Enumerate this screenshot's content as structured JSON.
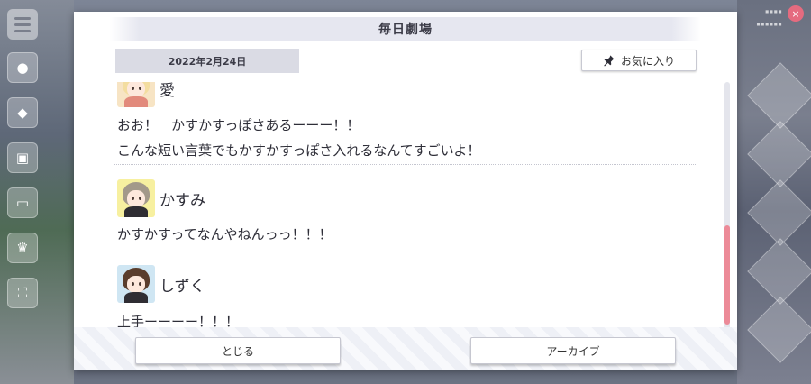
{
  "dialog": {
    "title": "毎日劇場",
    "date": "2022年2月24日",
    "favorite_label": "お気に入り",
    "close_label": "とじる",
    "archive_label": "アーカイブ"
  },
  "entries": [
    {
      "speaker": "愛",
      "lines": [
        "おお！　かすかすっぽさあるーーー！！",
        "こんな短い言葉でもかすかすっぽさ入れるなんてすごいよ！"
      ]
    },
    {
      "speaker": "かすみ",
      "lines": [
        "かすかすってなんやねんっっ！！！"
      ]
    },
    {
      "speaker": "しずく",
      "lines": [
        "上手ーーーー！！！"
      ]
    }
  ],
  "scrollbar": {
    "position_fraction": 0.58,
    "visible_fraction": 0.4
  },
  "colors": {
    "accent_pink": "#ec8a98",
    "avatar_ai_bg": "#f7e4c4",
    "avatar_kasumi_bg": "#f7f0a0",
    "avatar_shizuku_bg": "#cfe6f3"
  },
  "icons": {
    "favorite": "pin-icon",
    "menu": "hamburger-icon"
  }
}
